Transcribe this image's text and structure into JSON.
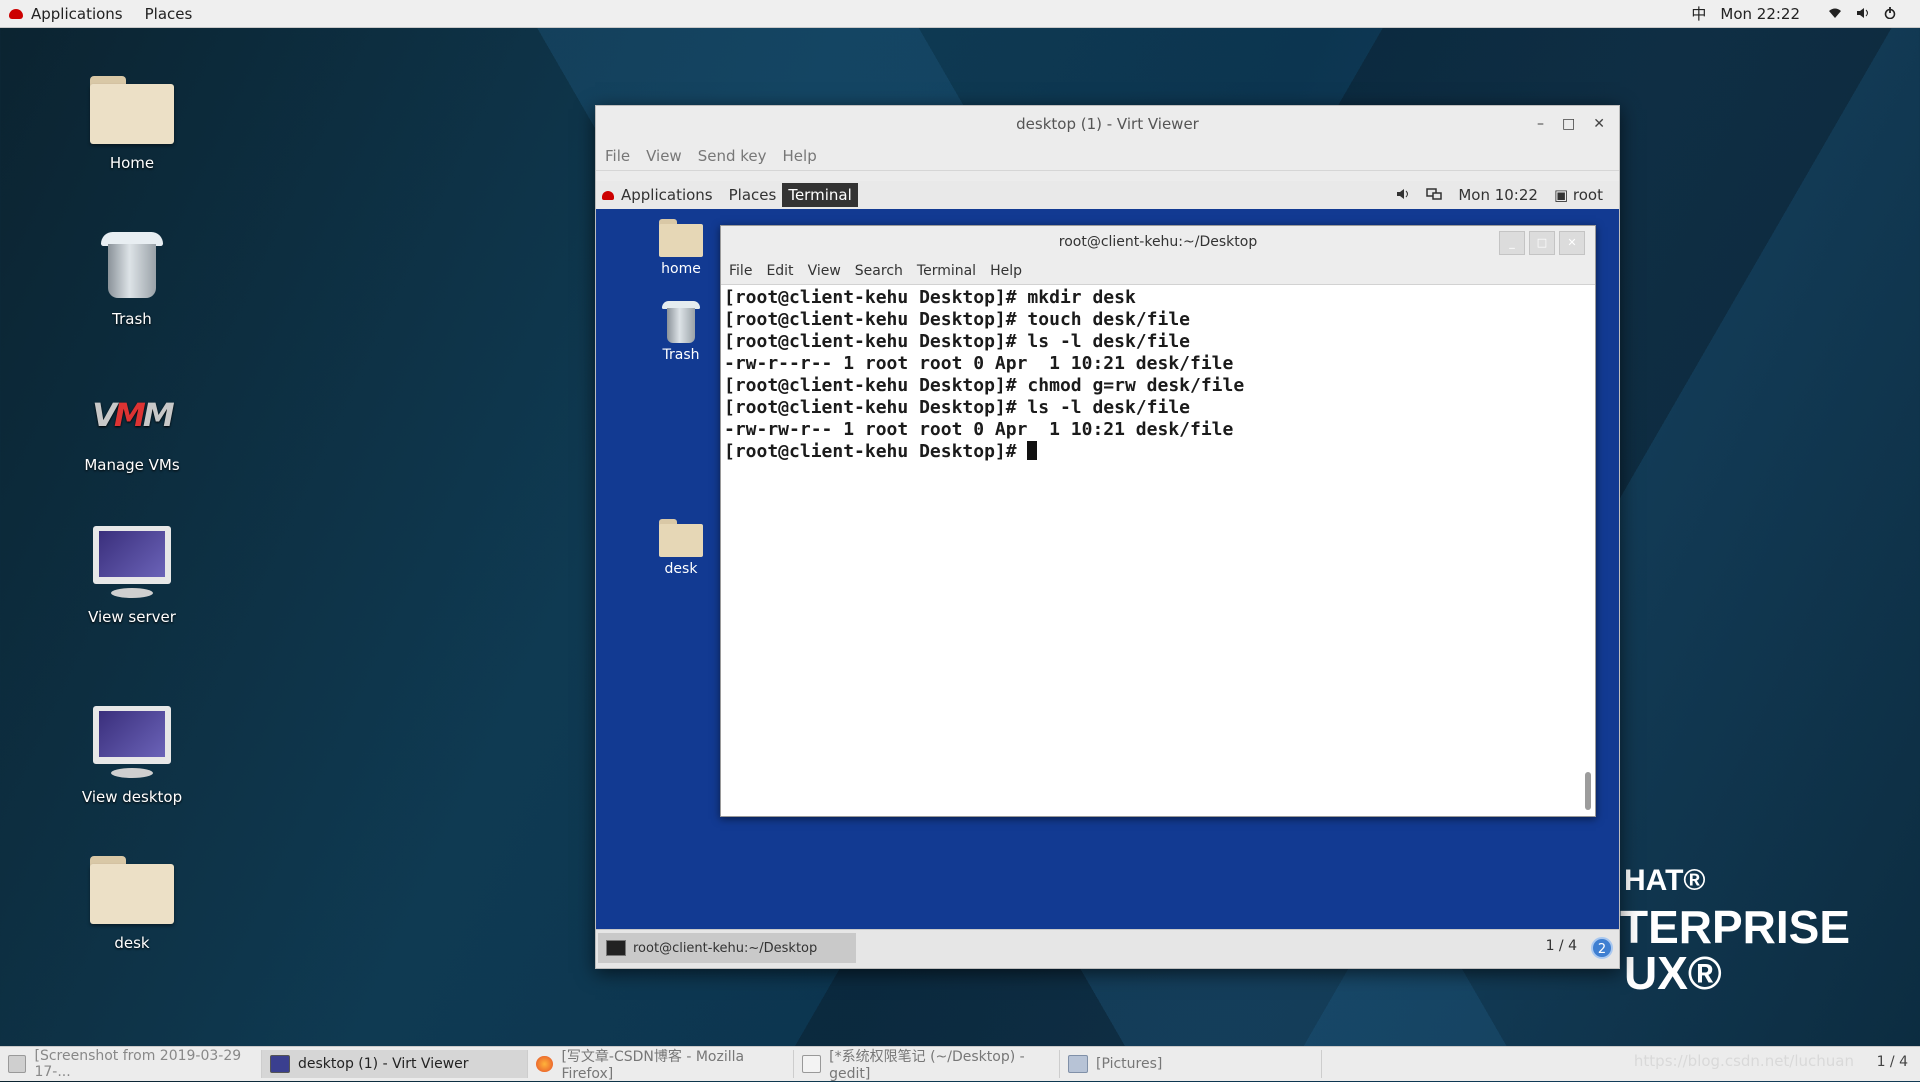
{
  "topbar": {
    "applications": "Applications",
    "places": "Places",
    "input_method": "中",
    "clock": "Mon 22:22"
  },
  "desktop_icons": [
    {
      "label": "Home"
    },
    {
      "label": "Trash"
    },
    {
      "label": "Manage VMs"
    },
    {
      "label": "View server"
    },
    {
      "label": "View desktop"
    },
    {
      "label": "desk"
    }
  ],
  "virt_viewer": {
    "title": "desktop (1) - Virt Viewer",
    "menu": [
      "File",
      "View",
      "Send key",
      "Help"
    ],
    "guest": {
      "topbar": {
        "applications": "Applications",
        "places": "Places",
        "terminal": "Terminal",
        "clock": "Mon 10:22",
        "user": "root"
      },
      "icons": [
        {
          "label": "home"
        },
        {
          "label": "Trash"
        },
        {
          "label": "desk"
        }
      ],
      "terminal": {
        "title": "root@client-kehu:~/Desktop",
        "menu": [
          "File",
          "Edit",
          "View",
          "Search",
          "Terminal",
          "Help"
        ],
        "lines": [
          "[root@client-kehu Desktop]# mkdir desk",
          "[root@client-kehu Desktop]# touch desk/file",
          "[root@client-kehu Desktop]# ls -l desk/file",
          "-rw-r--r-- 1 root root 0 Apr  1 10:21 desk/file",
          "[root@client-kehu Desktop]# chmod g=rw desk/file",
          "[root@client-kehu Desktop]# ls -l desk/file",
          "-rw-rw-r-- 1 root root 0 Apr  1 10:21 desk/file",
          "[root@client-kehu Desktop]# "
        ]
      },
      "taskbar": {
        "item": "root@client-kehu:~/Desktop",
        "workspace": "1 / 4",
        "help": "2"
      }
    }
  },
  "brand": {
    "line1": "HAT®",
    "line2": "TERPRISE",
    "line3": "UX®"
  },
  "taskbar": {
    "items": [
      "[Screenshot from 2019-03-29 17-...",
      "desktop (1) - Virt Viewer",
      "[写文章-CSDN博客 - Mozilla Firefox]",
      "[*系统权限笔记 (~/Desktop) - gedit]",
      "[Pictures]"
    ],
    "watermark": "https://blog.csdn.net/luchuan",
    "workspace": "1 / 4"
  },
  "colors": {
    "guest_bg": "#123a92",
    "desktop_bg": "#0f3a52"
  }
}
